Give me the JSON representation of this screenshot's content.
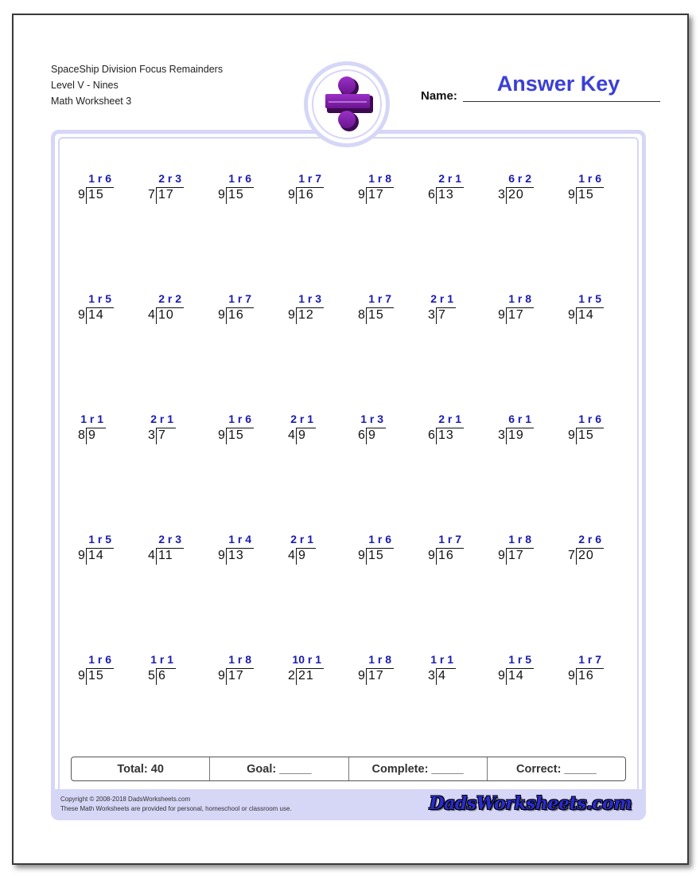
{
  "header": {
    "title_lines": [
      "SpaceShip Division Focus Remainders",
      "Level V - Nines",
      "Math Worksheet 3"
    ],
    "name_label": "Name:",
    "name_value": "Answer Key",
    "logo_icon": "division-sign-icon"
  },
  "colors": {
    "answer": "#1a1ab0",
    "answer_key": "#3b3fd8",
    "frame": "#d6d6f7",
    "logo": "#7a1a9c"
  },
  "problems": [
    [
      {
        "divisor": "9",
        "dividend": "15",
        "answer": "1 r 6"
      },
      {
        "divisor": "7",
        "dividend": "17",
        "answer": "2 r 3"
      },
      {
        "divisor": "9",
        "dividend": "15",
        "answer": "1 r 6"
      },
      {
        "divisor": "9",
        "dividend": "16",
        "answer": "1 r 7"
      },
      {
        "divisor": "9",
        "dividend": "17",
        "answer": "1 r 8"
      },
      {
        "divisor": "6",
        "dividend": "13",
        "answer": "2 r 1"
      },
      {
        "divisor": "3",
        "dividend": "20",
        "answer": "6 r 2"
      },
      {
        "divisor": "9",
        "dividend": "15",
        "answer": "1 r 6"
      }
    ],
    [
      {
        "divisor": "9",
        "dividend": "14",
        "answer": "1 r 5"
      },
      {
        "divisor": "4",
        "dividend": "10",
        "answer": "2 r 2"
      },
      {
        "divisor": "9",
        "dividend": "16",
        "answer": "1 r 7"
      },
      {
        "divisor": "9",
        "dividend": "12",
        "answer": "1 r 3"
      },
      {
        "divisor": "8",
        "dividend": "15",
        "answer": "1 r 7"
      },
      {
        "divisor": "3",
        "dividend": "7",
        "answer": "2 r 1"
      },
      {
        "divisor": "9",
        "dividend": "17",
        "answer": "1 r 8"
      },
      {
        "divisor": "9",
        "dividend": "14",
        "answer": "1 r 5"
      }
    ],
    [
      {
        "divisor": "8",
        "dividend": "9",
        "answer": "1 r 1"
      },
      {
        "divisor": "3",
        "dividend": "7",
        "answer": "2 r 1"
      },
      {
        "divisor": "9",
        "dividend": "15",
        "answer": "1 r 6"
      },
      {
        "divisor": "4",
        "dividend": "9",
        "answer": "2 r 1"
      },
      {
        "divisor": "6",
        "dividend": "9",
        "answer": "1 r 3"
      },
      {
        "divisor": "6",
        "dividend": "13",
        "answer": "2 r 1"
      },
      {
        "divisor": "3",
        "dividend": "19",
        "answer": "6 r 1"
      },
      {
        "divisor": "9",
        "dividend": "15",
        "answer": "1 r 6"
      }
    ],
    [
      {
        "divisor": "9",
        "dividend": "14",
        "answer": "1 r 5"
      },
      {
        "divisor": "4",
        "dividend": "11",
        "answer": "2 r 3"
      },
      {
        "divisor": "9",
        "dividend": "13",
        "answer": "1 r 4"
      },
      {
        "divisor": "4",
        "dividend": "9",
        "answer": "2 r 1"
      },
      {
        "divisor": "9",
        "dividend": "15",
        "answer": "1 r 6"
      },
      {
        "divisor": "9",
        "dividend": "16",
        "answer": "1 r 7"
      },
      {
        "divisor": "9",
        "dividend": "17",
        "answer": "1 r 8"
      },
      {
        "divisor": "7",
        "dividend": "20",
        "answer": "2 r 6"
      }
    ],
    [
      {
        "divisor": "9",
        "dividend": "15",
        "answer": "1 r 6"
      },
      {
        "divisor": "5",
        "dividend": "6",
        "answer": "1 r 1"
      },
      {
        "divisor": "9",
        "dividend": "17",
        "answer": "1 r 8"
      },
      {
        "divisor": "2",
        "dividend": "21",
        "answer": "10 r 1"
      },
      {
        "divisor": "9",
        "dividend": "17",
        "answer": "1 r 8"
      },
      {
        "divisor": "3",
        "dividend": "4",
        "answer": "1 r 1"
      },
      {
        "divisor": "9",
        "dividend": "14",
        "answer": "1 r 5"
      },
      {
        "divisor": "9",
        "dividend": "16",
        "answer": "1 r 7"
      }
    ]
  ],
  "score_bar": {
    "total": "Total: 40",
    "goal": "Goal: _____",
    "complete": "Complete: _____",
    "correct": "Correct: _____"
  },
  "footer": {
    "copyright": "Copyright © 2008-2018 DadsWorksheets.com",
    "usage": "These Math Worksheets are provided for personal, homeschool or classroom use.",
    "brand": "DadsWorksheets.com"
  }
}
